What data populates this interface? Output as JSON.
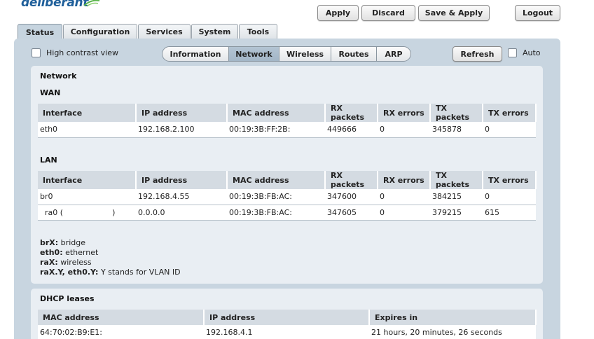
{
  "brand": {
    "name": "deliberant"
  },
  "toolbar": {
    "apply": "Apply",
    "discard": "Discard",
    "save_apply": "Save & Apply",
    "logout": "Logout"
  },
  "main_tabs": [
    "Status",
    "Configuration",
    "Services",
    "System",
    "Tools"
  ],
  "options": {
    "high_contrast": "High contrast view",
    "refresh": "Refresh",
    "auto": "Auto"
  },
  "sub_tabs": [
    "Information",
    "Network",
    "Wireless",
    "Routes",
    "ARP"
  ],
  "network": {
    "title": "Network",
    "wan": {
      "title": "WAN",
      "headers": [
        "Interface",
        "IP address",
        "MAC address",
        "RX packets",
        "RX errors",
        "TX packets",
        "TX errors"
      ],
      "rows": [
        [
          "eth0",
          "192.168.2.100",
          "00:19:3B:FF:2B:",
          "449666",
          "0",
          "345878",
          "0"
        ]
      ]
    },
    "lan": {
      "title": "LAN",
      "headers": [
        "Interface",
        "IP address",
        "MAC address",
        "RX packets",
        "RX errors",
        "TX packets",
        "TX errors"
      ],
      "rows": [
        [
          "br0",
          "192.168.4.55",
          "00:19:3B:FB:AC:",
          "347600",
          "0",
          "384215",
          "0"
        ],
        [
          "ra0 (",
          "0.0.0.0",
          "00:19:3B:FB:AC:",
          "347605",
          "0",
          "379215",
          "615"
        ]
      ],
      "ra0_suffix": ")"
    },
    "legend": [
      {
        "key": "brX:",
        "text": " bridge"
      },
      {
        "key": "eth0:",
        "text": " ethernet"
      },
      {
        "key": "raX:",
        "text": " wireless"
      },
      {
        "key": "raX.Y, eth0.Y:",
        "text": " Y stands for VLAN ID"
      }
    ]
  },
  "dhcp": {
    "title": "DHCP leases",
    "headers": [
      "MAC address",
      "IP address",
      "Expires in"
    ],
    "rows": [
      [
        "64:70:02:B9:E1:",
        "192.168.4.1",
        "21 hours, 20 minutes, 26 seconds"
      ]
    ]
  },
  "colors": {
    "panel": "#c8d5e0",
    "section": "#e9eef3",
    "header_cell": "#d4dbe2",
    "brand": "#1f5f9a"
  }
}
